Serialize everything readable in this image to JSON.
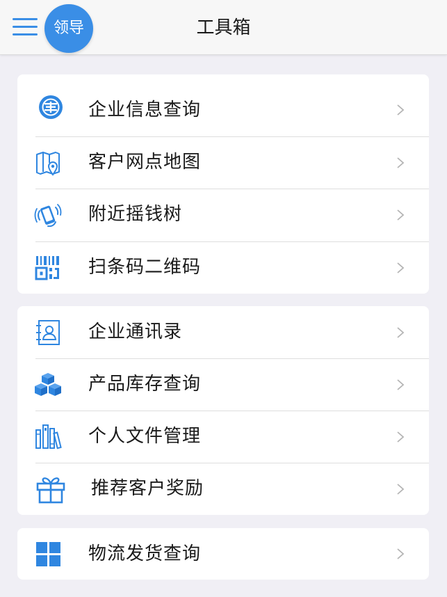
{
  "header": {
    "title": "工具箱",
    "avatar_text": "领导",
    "menu_icon": "hamburger-menu-icon"
  },
  "colors": {
    "accent": "#3a8ee6",
    "background": "#f0eff5",
    "card": "#ffffff"
  },
  "groups": [
    {
      "items": [
        {
          "label": "企业信息查询",
          "icon": "enterprise-badge-icon"
        },
        {
          "label": "客户网点地图",
          "icon": "map-pin-icon"
        },
        {
          "label": "附近摇钱树",
          "icon": "shake-phone-icon"
        },
        {
          "label": "扫条码二维码",
          "icon": "barcode-icon"
        }
      ]
    },
    {
      "items": [
        {
          "label": "企业通讯录",
          "icon": "contacts-icon"
        },
        {
          "label": "产品库存查询",
          "icon": "boxes-icon"
        },
        {
          "label": "个人文件管理",
          "icon": "files-icon"
        },
        {
          "label": "推荐客户奖励",
          "icon": "gift-icon"
        }
      ]
    },
    {
      "items": [
        {
          "label": "物流发货查询",
          "icon": "grid-icon"
        }
      ]
    }
  ]
}
